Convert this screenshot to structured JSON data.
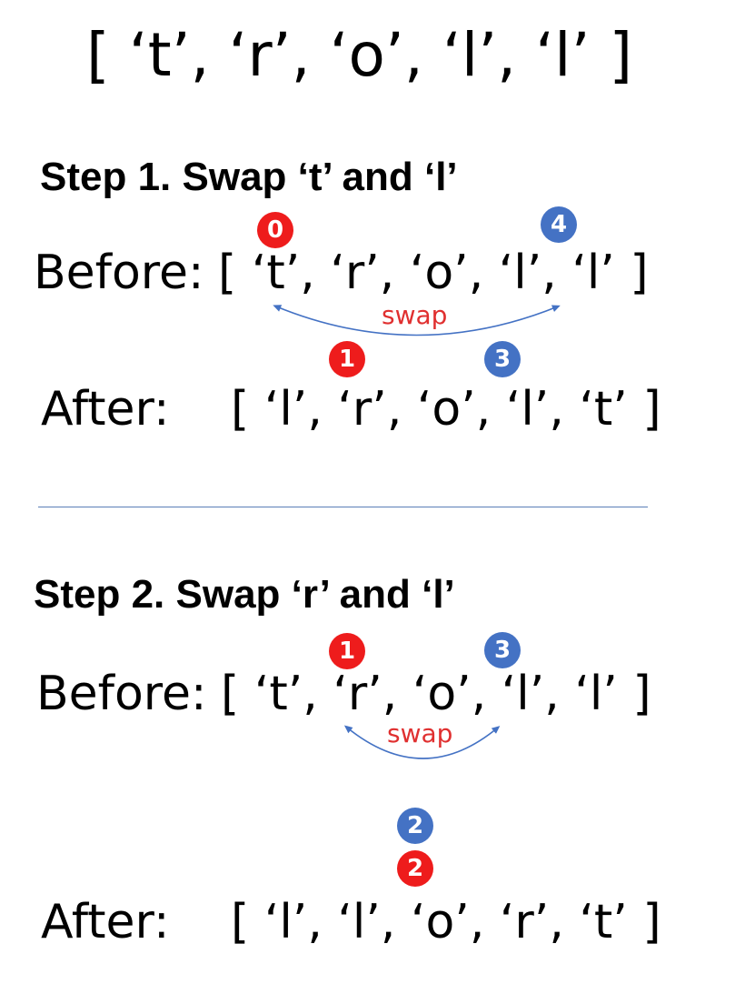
{
  "original_array": "[ ‘t’, ‘r’, ‘o’, ‘l’, ‘l’ ]",
  "steps": [
    {
      "title": "Step 1. Swap ‘t’ and ‘l’",
      "before_label": "Before:",
      "before_array": "[ ‘t’, ‘r’, ‘o’, ‘l’, ‘l’ ]",
      "before_badges": [
        "0",
        "4"
      ],
      "swap_label": "swap",
      "after_badges": [
        "1",
        "3"
      ],
      "after_label": "After:",
      "after_array": "[ ‘l’, ‘r’, ‘o’, ‘l’, ‘t’ ]"
    },
    {
      "title": "Step 2. Swap ‘r’ and ‘l’",
      "before_label": "Before:",
      "before_array": "[ ‘t’, ‘r’, ‘o’, ‘l’, ‘l’ ]",
      "before_badges": [
        "1",
        "3"
      ],
      "swap_label": "swap",
      "after_badges": [
        "2",
        "2"
      ],
      "after_label": "After:",
      "after_array": "[ ‘l’, ‘l’, ‘o’, ‘r’, ‘t’ ]"
    }
  ],
  "colors": {
    "left_pointer": "#ee1c1c",
    "right_pointer": "#4472c4",
    "swap_text": "#e03030",
    "arrow": "#4472c4"
  }
}
